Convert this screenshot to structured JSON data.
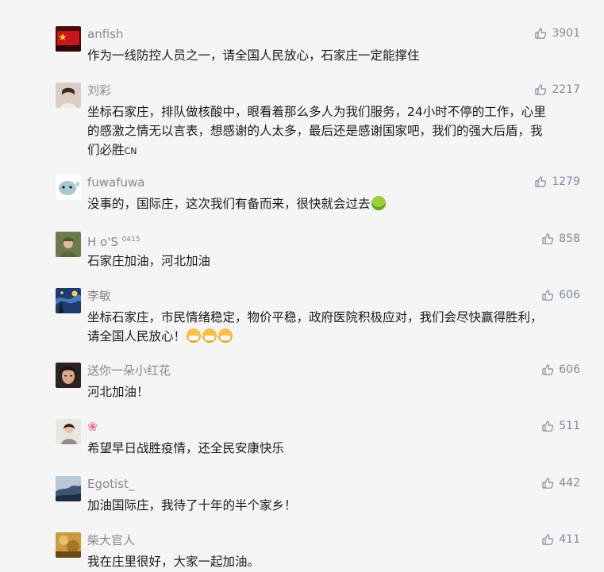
{
  "comments": [
    {
      "name": "anfish",
      "likes": "3901",
      "lines": [
        "作为一线防控人员之一，请全国人民放心，石家庄一定能撑住"
      ],
      "avatar": "red-flag-avatar"
    },
    {
      "name": "刘彩",
      "likes": "2217",
      "lines": [
        "坐标石家庄，排队做核酸中，眼看着那么多人为我们服务，24小时不停的工作，心里",
        "的感激之情无以言表，想感谢的人太多，最后还是感谢国家吧，我们的强大后盾，我",
        "们必胜"
      ],
      "suffix": "CN",
      "avatar": "woman-photo-avatar"
    },
    {
      "name": "fuwafuwa",
      "likes": "1279",
      "lines": [
        "没事的，国际庄，这次我们有备而来，很快就会过去"
      ],
      "avatar": "cartoon-avatar"
    },
    {
      "name": "H o'S",
      "name_sup": "0415",
      "likes": "858",
      "lines": [
        "石家庄加油，河北加油"
      ],
      "avatar": "soldier-avatar"
    },
    {
      "name": "李敏",
      "likes": "606",
      "lines": [
        "坐标石家庄，市民情绪稳定，物价平稳，政府医院积极应对，我们会尽快赢得胜利，",
        "请全国人民放心！"
      ],
      "avatar": "starry-night-avatar"
    },
    {
      "name": "送你一朵小红花",
      "likes": "606",
      "lines": [
        "河北加油！"
      ],
      "avatar": "portrait-avatar"
    },
    {
      "name": "❀",
      "likes": "511",
      "lines": [
        "希望早日战胜疫情，还全民安康快乐"
      ],
      "avatar": "girl-photo-avatar"
    },
    {
      "name": "Egotist_",
      "likes": "442",
      "lines": [
        "加油国际庄，我待了十年的半个家乡！"
      ],
      "avatar": "landscape-avatar"
    },
    {
      "name": "柴大官人",
      "likes": "411",
      "lines": [
        "我在庄里很好，大家一起加油。"
      ],
      "avatar": "golden-avatar"
    }
  ],
  "colors": {
    "name": "#888888",
    "like": "#7f8a9c",
    "text": "#1a1a1a",
    "background": "#f5f5f5"
  }
}
